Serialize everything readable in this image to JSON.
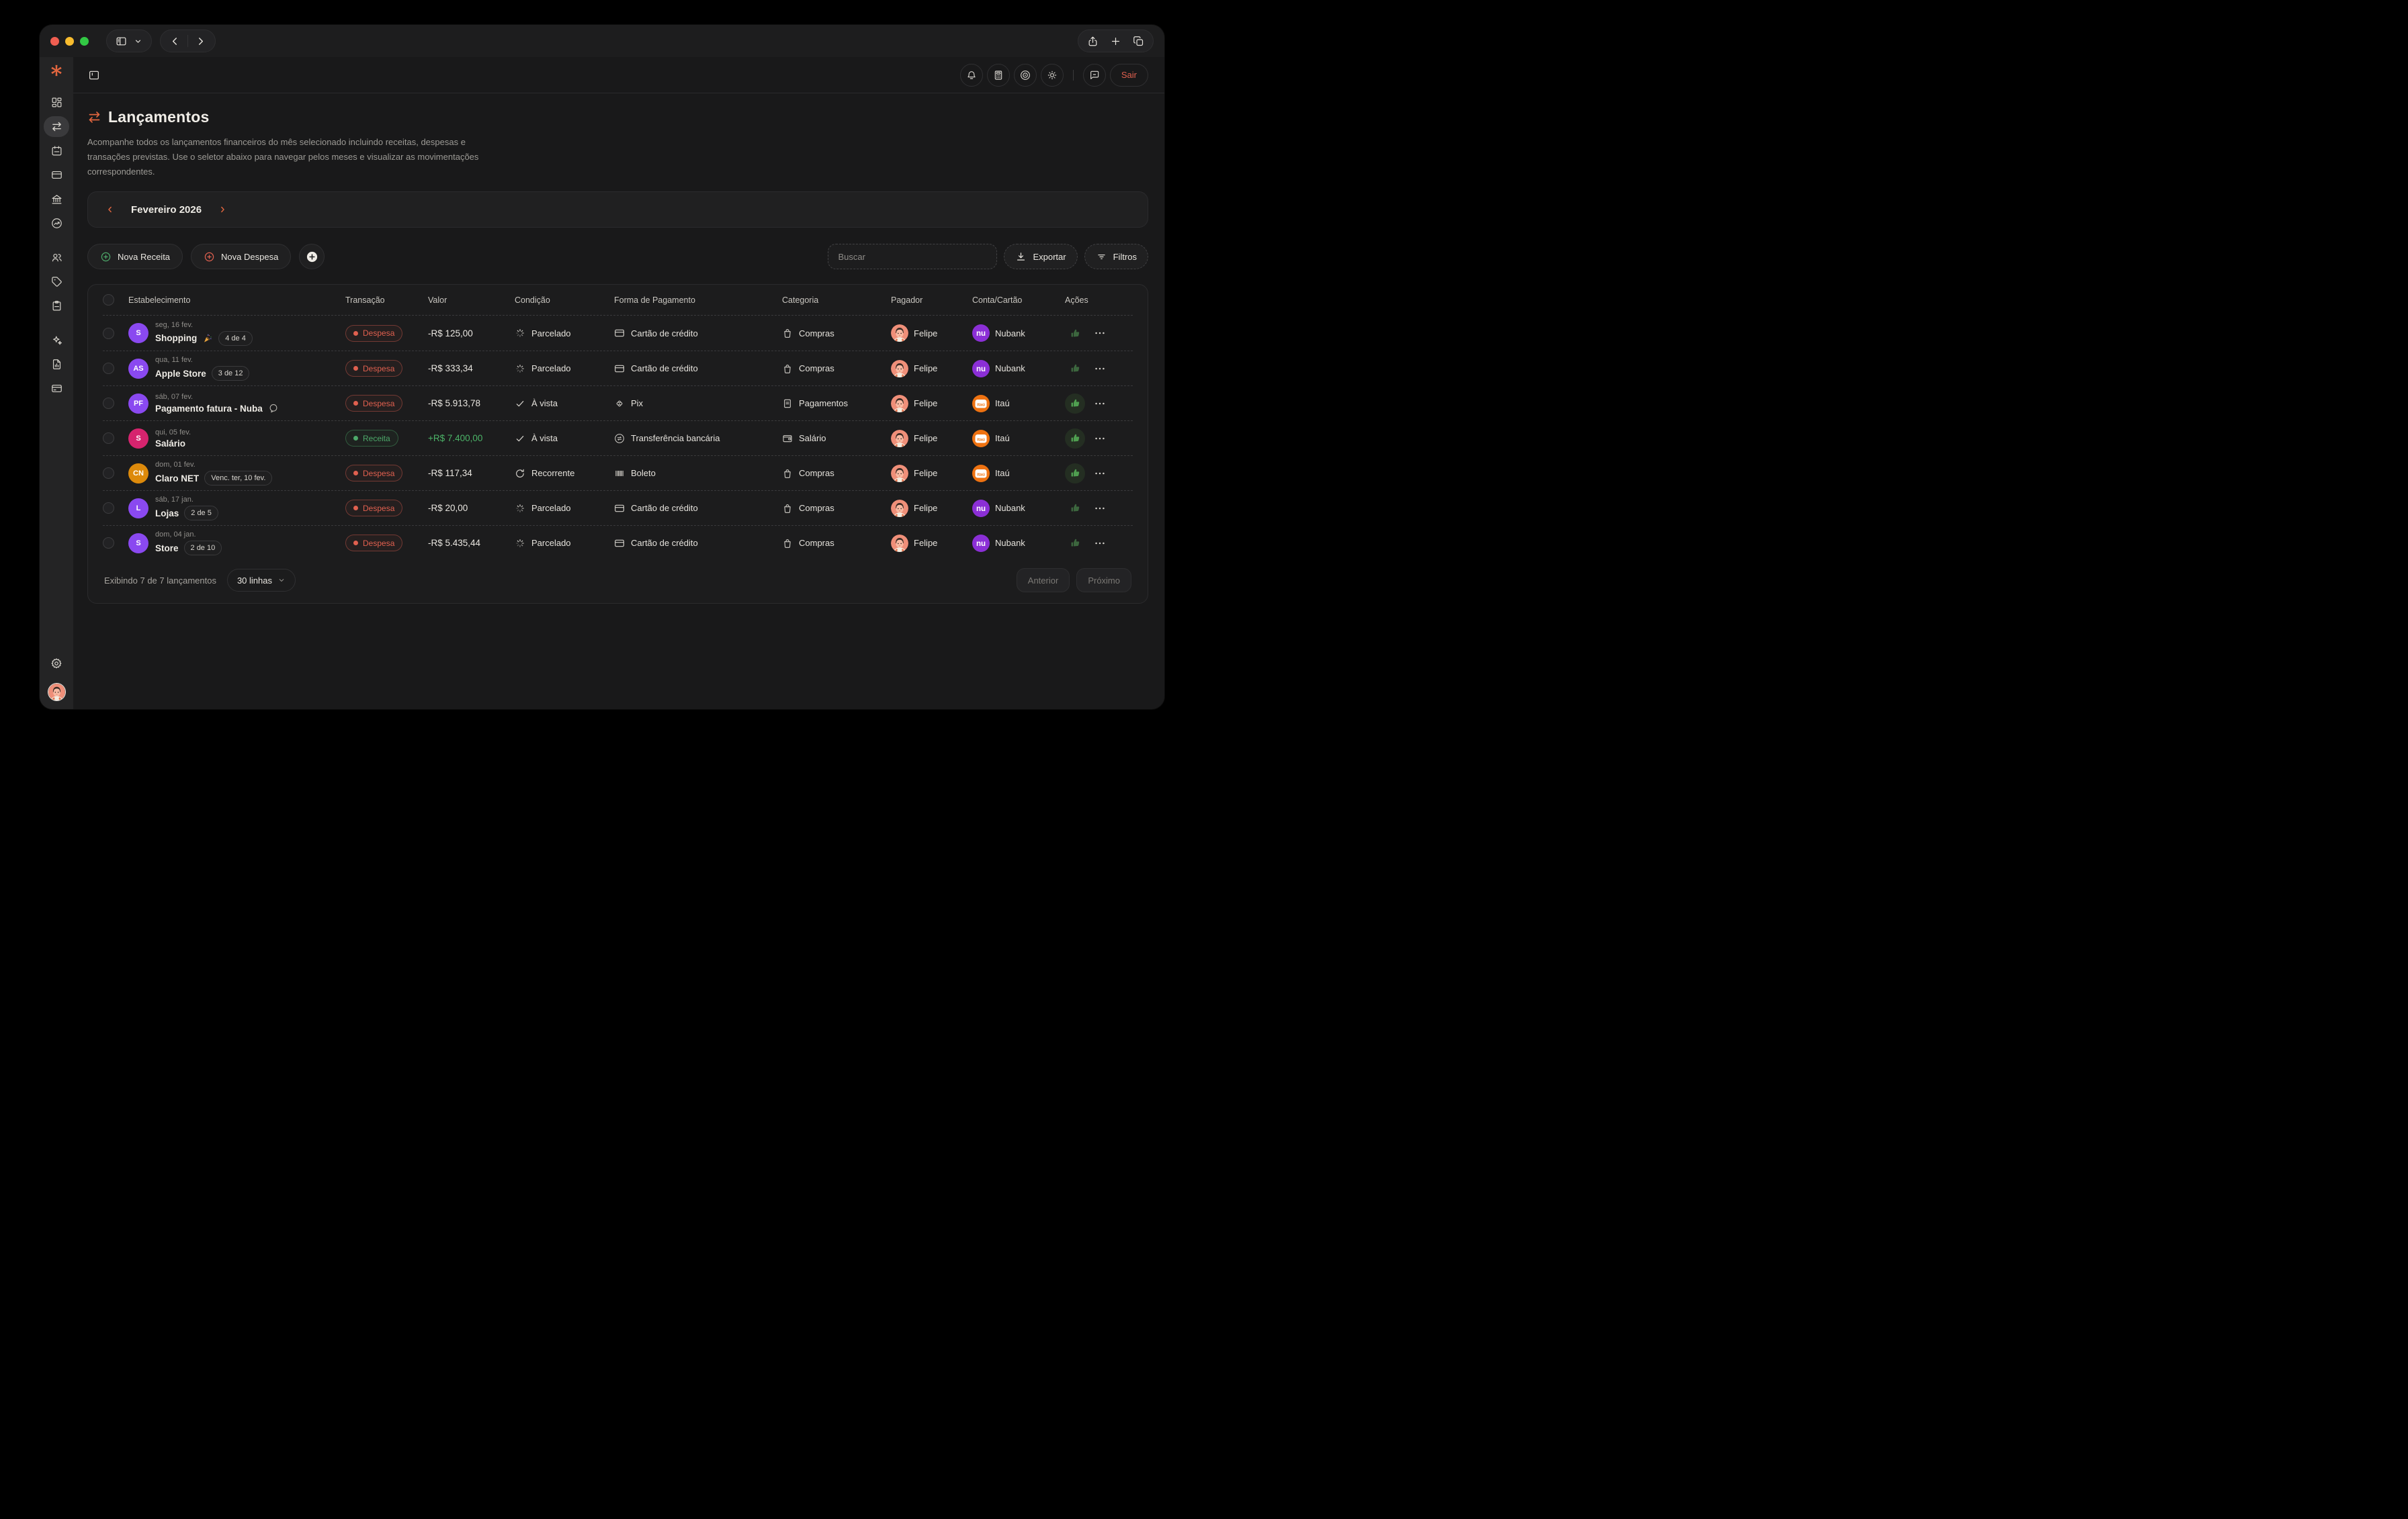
{
  "app_header": {
    "icons": [
      "bell",
      "calculator",
      "eye",
      "sun",
      "chat"
    ],
    "logout_label": "Sair"
  },
  "sidebar": {
    "groups": [
      [
        "dashboard",
        "transactions",
        "calendar",
        "card",
        "bank",
        "performance"
      ],
      [
        "users",
        "tag",
        "clipboard"
      ],
      [
        "ai",
        "report",
        "accounts"
      ]
    ],
    "active": "transactions"
  },
  "page": {
    "title": "Lançamentos",
    "description": "Acompanhe todos os lançamentos financeiros do mês selecionado incluindo receitas, despesas e transações previstas. Use o seletor abaixo para navegar pelos meses e visualizar as movimentações correspondentes."
  },
  "month_selector": {
    "label": "Fevereiro 2026"
  },
  "toolbar": {
    "new_income_label": "Nova Receita",
    "new_expense_label": "Nova Despesa",
    "search_placeholder": "Buscar",
    "export_label": "Exportar",
    "filters_label": "Filtros"
  },
  "table": {
    "headers": [
      "Estabelecimento",
      "Transação",
      "Valor",
      "Condição",
      "Forma de Pagamento",
      "Categoria",
      "Pagador",
      "Conta/Cartão",
      "Ações"
    ],
    "rows": [
      {
        "date": "seg, 16 fev.",
        "name": "Shopping",
        "emoji": "🎉",
        "initials": "S",
        "avatar_color": "#8a49f0",
        "badge": "4 de 4",
        "type": "Despesa",
        "value": "-R$ 125,00",
        "condition": {
          "icon": "spinner",
          "label": "Parcelado"
        },
        "payment": {
          "icon": "card",
          "label": "Cartão de crédito"
        },
        "category": {
          "icon": "bag",
          "label": "Compras"
        },
        "payer": "Felipe",
        "account": {
          "brand": "nubank",
          "label": "Nubank"
        },
        "thumb_active": false
      },
      {
        "date": "qua, 11 fev.",
        "name": "Apple Store",
        "initials": "AS",
        "avatar_color": "#8a49f0",
        "badge": "3 de 12",
        "type": "Despesa",
        "value": "-R$ 333,34",
        "condition": {
          "icon": "spinner",
          "label": "Parcelado"
        },
        "payment": {
          "icon": "card",
          "label": "Cartão de crédito"
        },
        "category": {
          "icon": "bag",
          "label": "Compras"
        },
        "payer": "Felipe",
        "account": {
          "brand": "nubank",
          "label": "Nubank"
        },
        "thumb_active": false
      },
      {
        "date": "sáb, 07 fev.",
        "name": "Pagamento fatura - Nuba",
        "initials": "PF",
        "avatar_color": "#8a49f0",
        "has_note": true,
        "type": "Despesa",
        "value": "-R$ 5.913,78",
        "condition": {
          "icon": "check",
          "label": "À vista"
        },
        "payment": {
          "icon": "pix",
          "label": "Pix"
        },
        "category": {
          "icon": "receipt",
          "label": "Pagamentos"
        },
        "payer": "Felipe",
        "account": {
          "brand": "itau",
          "label": "Itaú"
        },
        "thumb_active": true
      },
      {
        "date": "qui, 05 fev.",
        "name": "Salário",
        "initials": "S",
        "avatar_color": "#d6246e",
        "type": "Receita",
        "value": "+R$ 7.400,00",
        "condition": {
          "icon": "check",
          "label": "À vista"
        },
        "payment": {
          "icon": "transfer",
          "label": "Transferência bancária"
        },
        "category": {
          "icon": "wallet",
          "label": "Salário"
        },
        "payer": "Felipe",
        "account": {
          "brand": "itau",
          "label": "Itaú"
        },
        "thumb_active": true
      },
      {
        "date": "dom, 01 fev.",
        "name": "Claro NET",
        "initials": "CN",
        "avatar_color": "#dd8a0b",
        "badge": "Venc. ter, 10 fev.",
        "type": "Despesa",
        "value": "-R$ 117,34",
        "condition": {
          "icon": "refresh",
          "label": "Recorrente"
        },
        "payment": {
          "icon": "barcode",
          "label": "Boleto"
        },
        "category": {
          "icon": "bag",
          "label": "Compras"
        },
        "payer": "Felipe",
        "account": {
          "brand": "itau",
          "label": "Itaú"
        },
        "thumb_active": true
      },
      {
        "date": "sáb, 17 jan.",
        "name": "Lojas",
        "initials": "L",
        "avatar_color": "#8a49f0",
        "badge": "2 de 5",
        "type": "Despesa",
        "value": "-R$ 20,00",
        "condition": {
          "icon": "spinner",
          "label": "Parcelado"
        },
        "payment": {
          "icon": "card",
          "label": "Cartão de crédito"
        },
        "category": {
          "icon": "bag",
          "label": "Compras"
        },
        "payer": "Felipe",
        "account": {
          "brand": "nubank",
          "label": "Nubank"
        },
        "thumb_active": false
      },
      {
        "date": "dom, 04 jan.",
        "name": "Store",
        "initials": "S",
        "avatar_color": "#8a49f0",
        "badge": "2 de 10",
        "type": "Despesa",
        "value": "-R$ 5.435,44",
        "condition": {
          "icon": "spinner",
          "label": "Parcelado"
        },
        "payment": {
          "icon": "card",
          "label": "Cartão de crédito"
        },
        "category": {
          "icon": "bag",
          "label": "Compras"
        },
        "payer": "Felipe",
        "account": {
          "brand": "nubank",
          "label": "Nubank"
        },
        "thumb_active": false
      }
    ]
  },
  "footer": {
    "summary": "Exibindo 7 de 7 lançamentos",
    "page_size": "30 linhas",
    "prev_label": "Anterior",
    "next_label": "Próximo"
  },
  "colors": {
    "accent_orange": "#e2663f",
    "expense_red": "#e0604f",
    "income_green": "#4da96a",
    "positive_value": "#4cb468",
    "nubank_purple": "#8b2fd6",
    "itau_orange": "#ee7211",
    "avatar_purple": "#8a49f0",
    "avatar_pink": "#d6246e",
    "avatar_orange": "#dd8a0b"
  }
}
